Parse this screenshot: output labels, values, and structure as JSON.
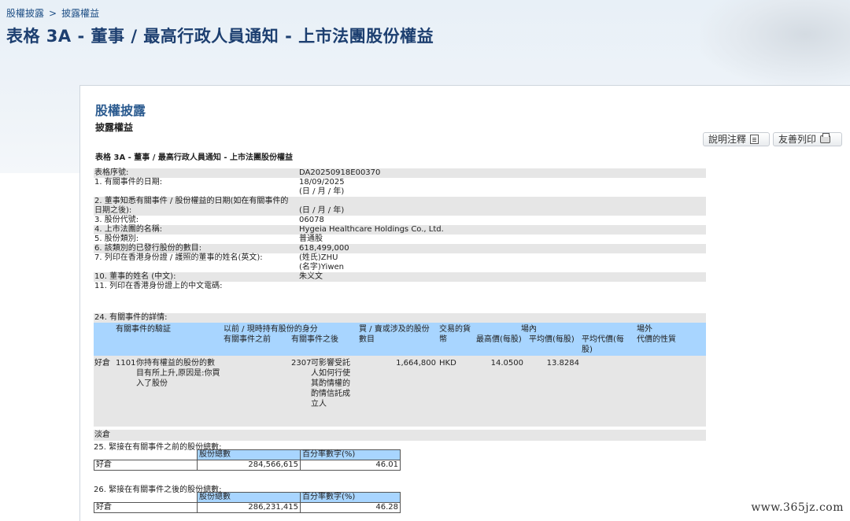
{
  "breadcrumb": [
    "股權披露",
    ">",
    "披露權益"
  ],
  "page_title": "表格 3A - 董事 / 最高行政人員通知 - 上市法團股份權益",
  "panel": {
    "title": "股權披露",
    "subtitle": "披露權益",
    "notes_button": "說明注釋",
    "print_button": "友善列印",
    "form_title": "表格 3A - 董事 / 最高行政人員通知 - 上市法團股份權益"
  },
  "rows": [
    {
      "label": "表格序號:",
      "value": "DA20250918E00370",
      "value2": ""
    },
    {
      "label": "1. 有關事件的日期:",
      "value": "18/09/2025",
      "value2": "(日 / 月 / 年)"
    },
    {
      "label": "2. 董事知悉有關事件 / 股份權益的日期(如在有關事件的日期之後):",
      "value": "",
      "value2": "(日 / 月 / 年)"
    },
    {
      "label": "3. 股份代號:",
      "value": "06078",
      "value2": ""
    },
    {
      "label": "4. 上市法團的名稱:",
      "value": "Hygeia Healthcare Holdings Co., Ltd.",
      "value2": ""
    },
    {
      "label": "5. 股份類別:",
      "value": "普通股",
      "value2": ""
    },
    {
      "label": "6. 該類別的已發行股份的數目:",
      "value": "618,499,000",
      "value2": ""
    },
    {
      "label": "7. 列印在香港身份證 / 護照的董事的姓名(英文):",
      "value": "(姓氏)ZHU",
      "value2": "(名字)Yiwen"
    },
    {
      "label": "10. 董事的姓名 (中文):",
      "value": "朱义文",
      "value2": ""
    },
    {
      "label": "11. 列印在香港身份證上的中文電碼:",
      "value": "",
      "value2": ""
    }
  ],
  "section24": {
    "label": "24. 有關事件的詳情:",
    "headers": {
      "event_code": "有關事件的驗証",
      "capacity": "以前 / 現時持有股份的身分",
      "before": "有關事件之前",
      "after": "有關事件之後",
      "shares": "買 / 賣或涉及的股份數目",
      "currency": "交易的貨幣",
      "onexchange": "場內",
      "highest": "最高價(每股)",
      "average": "平均價(每股)",
      "avg_consideration": "平均代價(每股)",
      "offexchange": "場外",
      "nature": "代價的性質"
    },
    "detail": {
      "position": "好倉",
      "code": "1101",
      "description": "你持有權益的股份的數目有所上升,原因是:你買入了股份",
      "capacity_before": "",
      "capacity_after_code": "2307",
      "capacity_after": "可影響受託人如何行使其酌情權的酌情信託成立人",
      "shares": "1,664,800",
      "currency": "HKD",
      "highest": "14.0500",
      "average": "13.8284"
    },
    "short_position": "淡倉"
  },
  "section25": {
    "label": "25. 緊接在有關事件之前的股份總數:",
    "col_total": "股份總數",
    "col_pct": "百分率數字(%)",
    "row_label": "好倉",
    "total": "284,566,615",
    "pct": "46.01"
  },
  "section26": {
    "label": "26. 緊接在有關事件之後的股份總數:",
    "col_total": "股份總數",
    "col_pct": "百分率數字(%)",
    "row_label": "好倉",
    "total": "286,231,415",
    "pct": "46.28"
  },
  "watermark": "www.365jz.com"
}
